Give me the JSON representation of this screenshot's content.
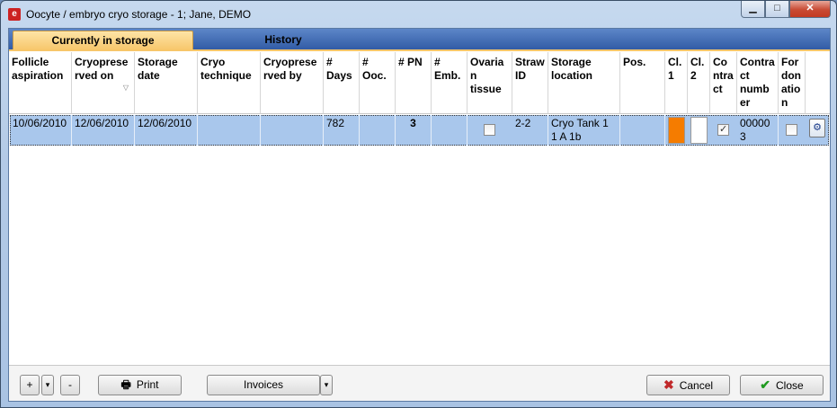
{
  "window": {
    "title": "Oocyte / embryo cryo storage - 1; Jane, DEMO",
    "app_icon": "e",
    "min": "▁",
    "max": "□",
    "close": "✕"
  },
  "tabs": [
    {
      "label": "Currently in storage"
    },
    {
      "label": "History"
    }
  ],
  "columns": [
    "Follicle aspiration",
    "Cryopreserved on",
    "Storage date",
    "Cryo technique",
    "Cryopreserved by",
    "# Days",
    "# Ooc.",
    "# PN",
    "# Emb.",
    "Ovarian tissue",
    "Straw ID",
    "Storage location",
    "Pos.",
    "Cl. 1",
    "Cl. 2",
    "Contract",
    "Contract number",
    "For donation"
  ],
  "sort_indicator": "▽",
  "rows": [
    {
      "follicle_aspiration": "10/06/2010",
      "cryopreserved_on": "12/06/2010",
      "storage_date": "12/06/2010",
      "cryo_technique": "",
      "cryopreserved_by": "",
      "days": "782",
      "ooc": "",
      "pn": "3",
      "emb": "",
      "ovarian_tissue": false,
      "straw_id": "2-2",
      "storage_location": "Cryo Tank 1 1 A 1b",
      "pos": "",
      "cl1_color": "#f57c00",
      "cl2_color": "#ffffff",
      "contract": true,
      "contract_number": "000003",
      "for_donation": false
    }
  ],
  "footer": {
    "add": "+",
    "dropdown": "▾",
    "remove": "-",
    "print": "Print",
    "invoices": "Invoices",
    "cancel": "Cancel",
    "close": "Close"
  }
}
